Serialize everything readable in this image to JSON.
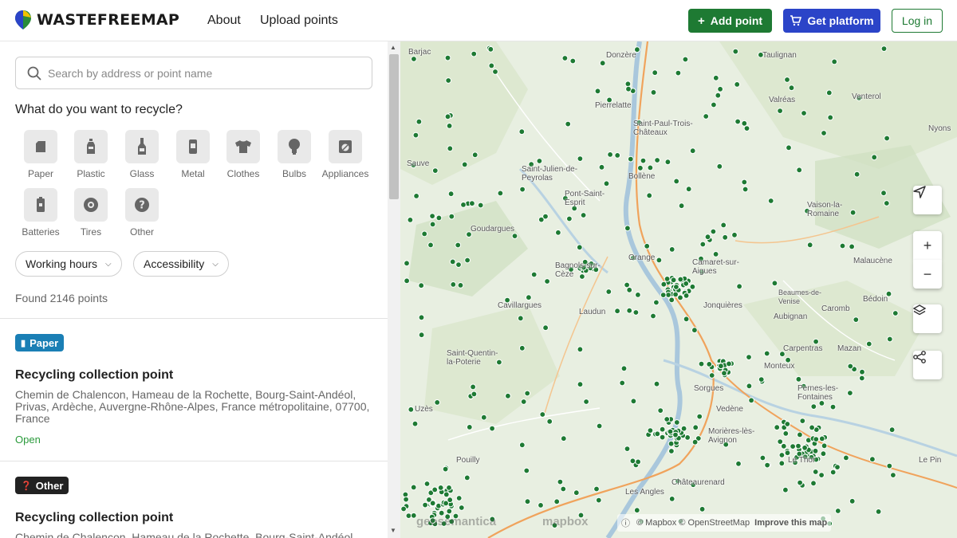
{
  "header": {
    "brand": "WASTEFREEMAP",
    "nav": [
      "About",
      "Upload points"
    ],
    "add_point": "Add point",
    "get_platform": "Get platform",
    "login": "Log in"
  },
  "sidebar": {
    "search_placeholder": "Search by address or point name",
    "section_title": "What do you want to recycle?",
    "categories": [
      {
        "label": "Paper",
        "icon": "paper-icon"
      },
      {
        "label": "Plastic",
        "icon": "plastic-bottle-icon"
      },
      {
        "label": "Glass",
        "icon": "glass-bottle-icon"
      },
      {
        "label": "Metal",
        "icon": "can-icon"
      },
      {
        "label": "Clothes",
        "icon": "tshirt-icon"
      },
      {
        "label": "Bulbs",
        "icon": "bulb-icon"
      },
      {
        "label": "Appliances",
        "icon": "appliance-icon"
      },
      {
        "label": "Batteries",
        "icon": "battery-icon"
      },
      {
        "label": "Tires",
        "icon": "tire-icon"
      },
      {
        "label": "Other",
        "icon": "question-icon"
      }
    ],
    "filters": [
      "Working hours",
      "Accessibility"
    ],
    "found": "Found 2146 points",
    "results": [
      {
        "badge": "Paper",
        "badge_color": "#1a7fb5",
        "title": "Recycling collection point",
        "address": "Chemin de Chalencon, Hameau de la Rochette, Bourg-Saint-Andéol, Privas, Ardèche, Auvergne-Rhône-Alpes, France métropolitaine, 07700, France",
        "status": "Open"
      },
      {
        "badge": "Other",
        "badge_color": "#222222",
        "title": "Recycling collection point",
        "address": "Chemin de Chalencon, Hameau de la Rochette, Bourg-Saint-Andéol,",
        "status": ""
      }
    ]
  },
  "map": {
    "places": [
      "Donzère",
      "Taulignan",
      "Pierrelatte",
      "Valréas",
      "Venterol",
      "Saint-Paul-Trois-Châteaux",
      "Nyons",
      "Bollène",
      "Saint-Julien-de-Peyrolas",
      "Pont-Saint-Esprit",
      "Vaison-la-Romaine",
      "Goudargues",
      "Orange",
      "Bagnols-sur-Cèze",
      "Camaret-sur-Aigues",
      "Malaucène",
      "Beaumes-de-Venise",
      "Bédoin",
      "Laudun",
      "Jonquières",
      "Caromb",
      "Aubignan",
      "Cavillargues",
      "Carpentras",
      "Mazan",
      "Saint-Quentin-la-Poterie",
      "Monteux",
      "Sorgues",
      "Pernes-les-Fontaines",
      "Vedène",
      "Morières-lès-Avignon",
      "Le Thor",
      "Pouilly",
      "Châteaurenard",
      "Uzès",
      "Les Angles",
      "Sauve",
      "Barjac",
      "Le Pin"
    ],
    "attribution": "© Mapbox © OpenStreetMap",
    "improve": "Improve this map",
    "watermark_1": "geosemantica",
    "watermark_2": "mapbox"
  },
  "colors": {
    "primary_green": "#1e7a33",
    "platform_blue": "#2b44c8",
    "marker": "#1e7a33"
  }
}
